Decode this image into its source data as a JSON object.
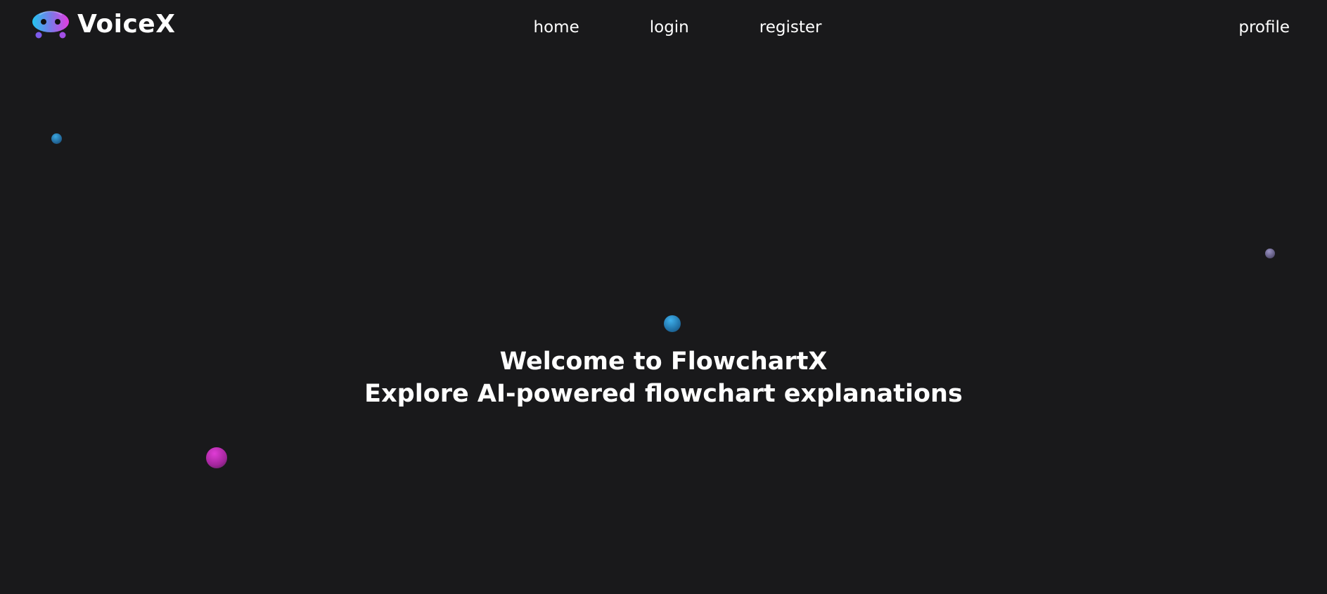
{
  "brand": {
    "name": "VoiceX",
    "logo_icon": "robot-face-icon",
    "colors": {
      "gradient_start": "#23c4f0",
      "gradient_end": "#e33ce0"
    }
  },
  "nav": {
    "home": "home",
    "login": "login",
    "register": "register",
    "profile": "profile"
  },
  "hero": {
    "line1": "Welcome to FlowchartX",
    "line2": "Explore AI-powered flowchart explanations"
  },
  "theme": {
    "background": "#19191b",
    "text": "#ffffff"
  }
}
